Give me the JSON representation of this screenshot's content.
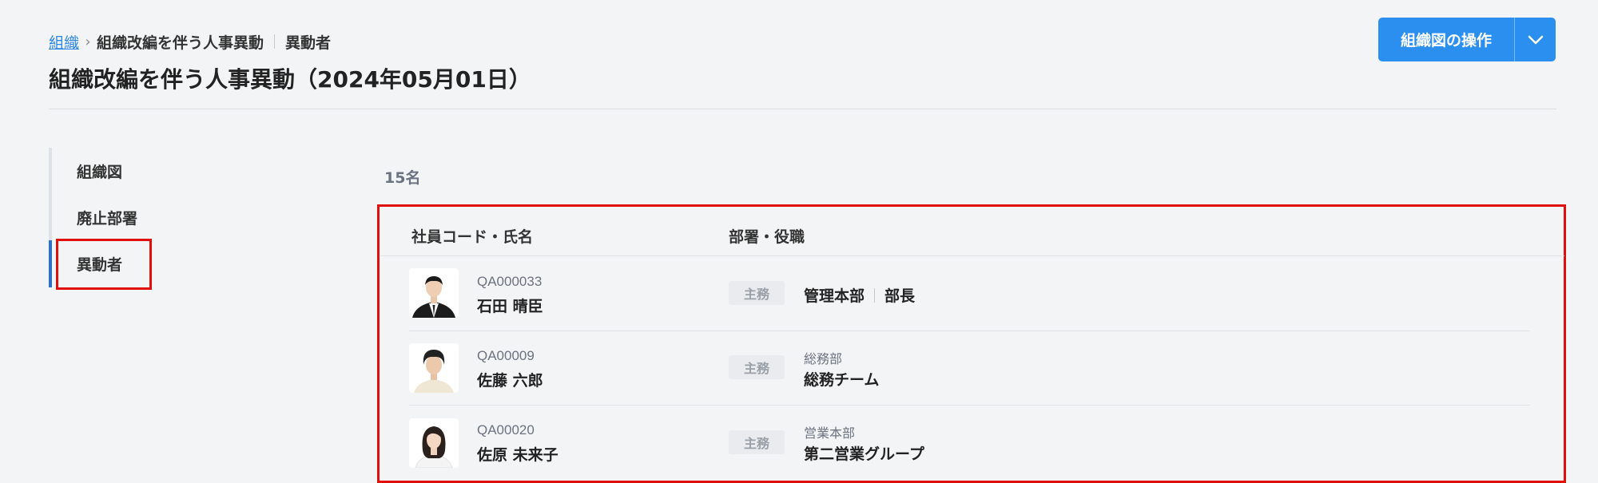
{
  "breadcrumb": {
    "root": "組織",
    "middle": "組織改編を伴う人事異動",
    "current": "異動者"
  },
  "page_title": "組織改編を伴う人事異動（2024年05月01日）",
  "action_button": {
    "label": "組織図の操作",
    "dropdown_icon": "chevron-down-icon"
  },
  "sidenav": {
    "items": [
      {
        "label": "組織図"
      },
      {
        "label": "廃止部署"
      },
      {
        "label": "異動者",
        "active": true
      }
    ]
  },
  "content": {
    "count": "15名",
    "columns": [
      "社員コード・氏名",
      "部署・役職"
    ],
    "rows": [
      {
        "code": "QA000033",
        "name": "石田 晴臣",
        "tag": "主務",
        "dept_sub": "",
        "dept_main": "管理本部",
        "role": "部長"
      },
      {
        "code": "QA00009",
        "name": "佐藤 六郎",
        "tag": "主務",
        "dept_sub": "総務部",
        "dept_main": "総務チーム",
        "role": ""
      },
      {
        "code": "QA00020",
        "name": "佐原 未来子",
        "tag": "主務",
        "dept_sub": "営業本部",
        "dept_main": "第二営業グループ",
        "role": ""
      }
    ]
  },
  "colors": {
    "accent": "#2b8ff0",
    "link": "#2b86e8",
    "active_indicator": "#2b6fd6",
    "highlight_box": "#e10e0e"
  }
}
